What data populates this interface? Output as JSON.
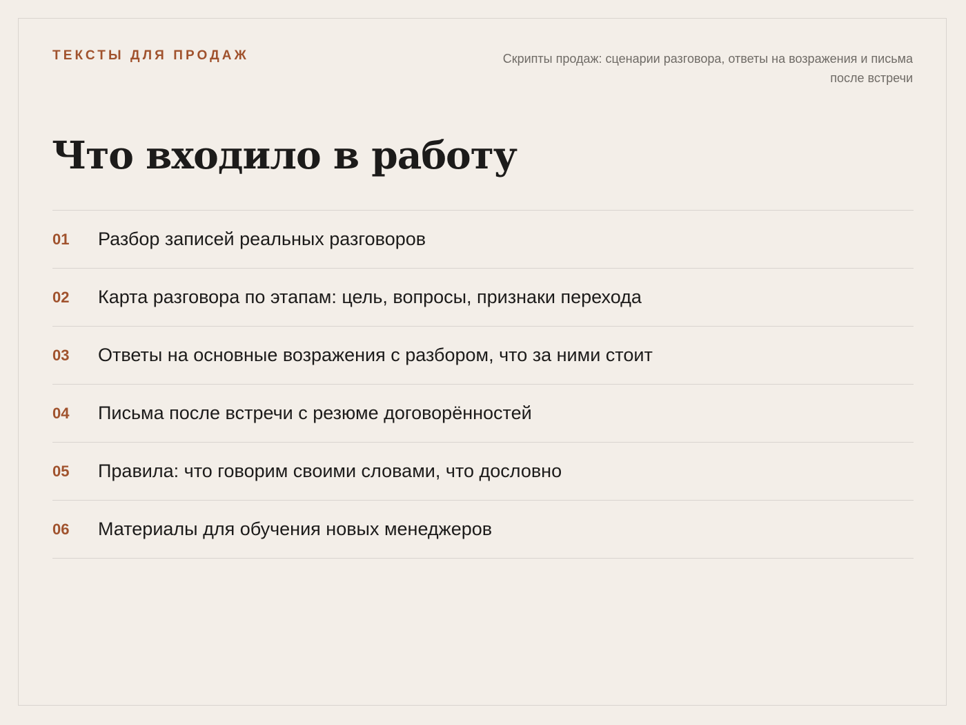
{
  "header": {
    "eyebrow": "ТЕКСТЫ ДЛЯ ПРОДАЖ",
    "subtitle": "Скрипты продаж: сценарии разговора, ответы на возражения и письма после встречи"
  },
  "title": "Что входило в работу",
  "items": [
    {
      "number": "01",
      "text": "Разбор записей реальных разговоров"
    },
    {
      "number": "02",
      "text": "Карта разговора по этапам: цель, вопросы, признаки перехода"
    },
    {
      "number": "03",
      "text": "Ответы на основные возражения с разбором, что за ними стоит"
    },
    {
      "number": "04",
      "text": "Письма после встречи с резюме договорённостей"
    },
    {
      "number": "05",
      "text": "Правила: что говорим своими словами, что дословно"
    },
    {
      "number": "06",
      "text": "Материалы для обучения новых менеджеров"
    }
  ],
  "colors": {
    "background": "#f3eee8",
    "accent": "#a0522d",
    "text": "#1c1b1a",
    "muted": "#6f6b66",
    "divider": "#d9d4cf"
  }
}
